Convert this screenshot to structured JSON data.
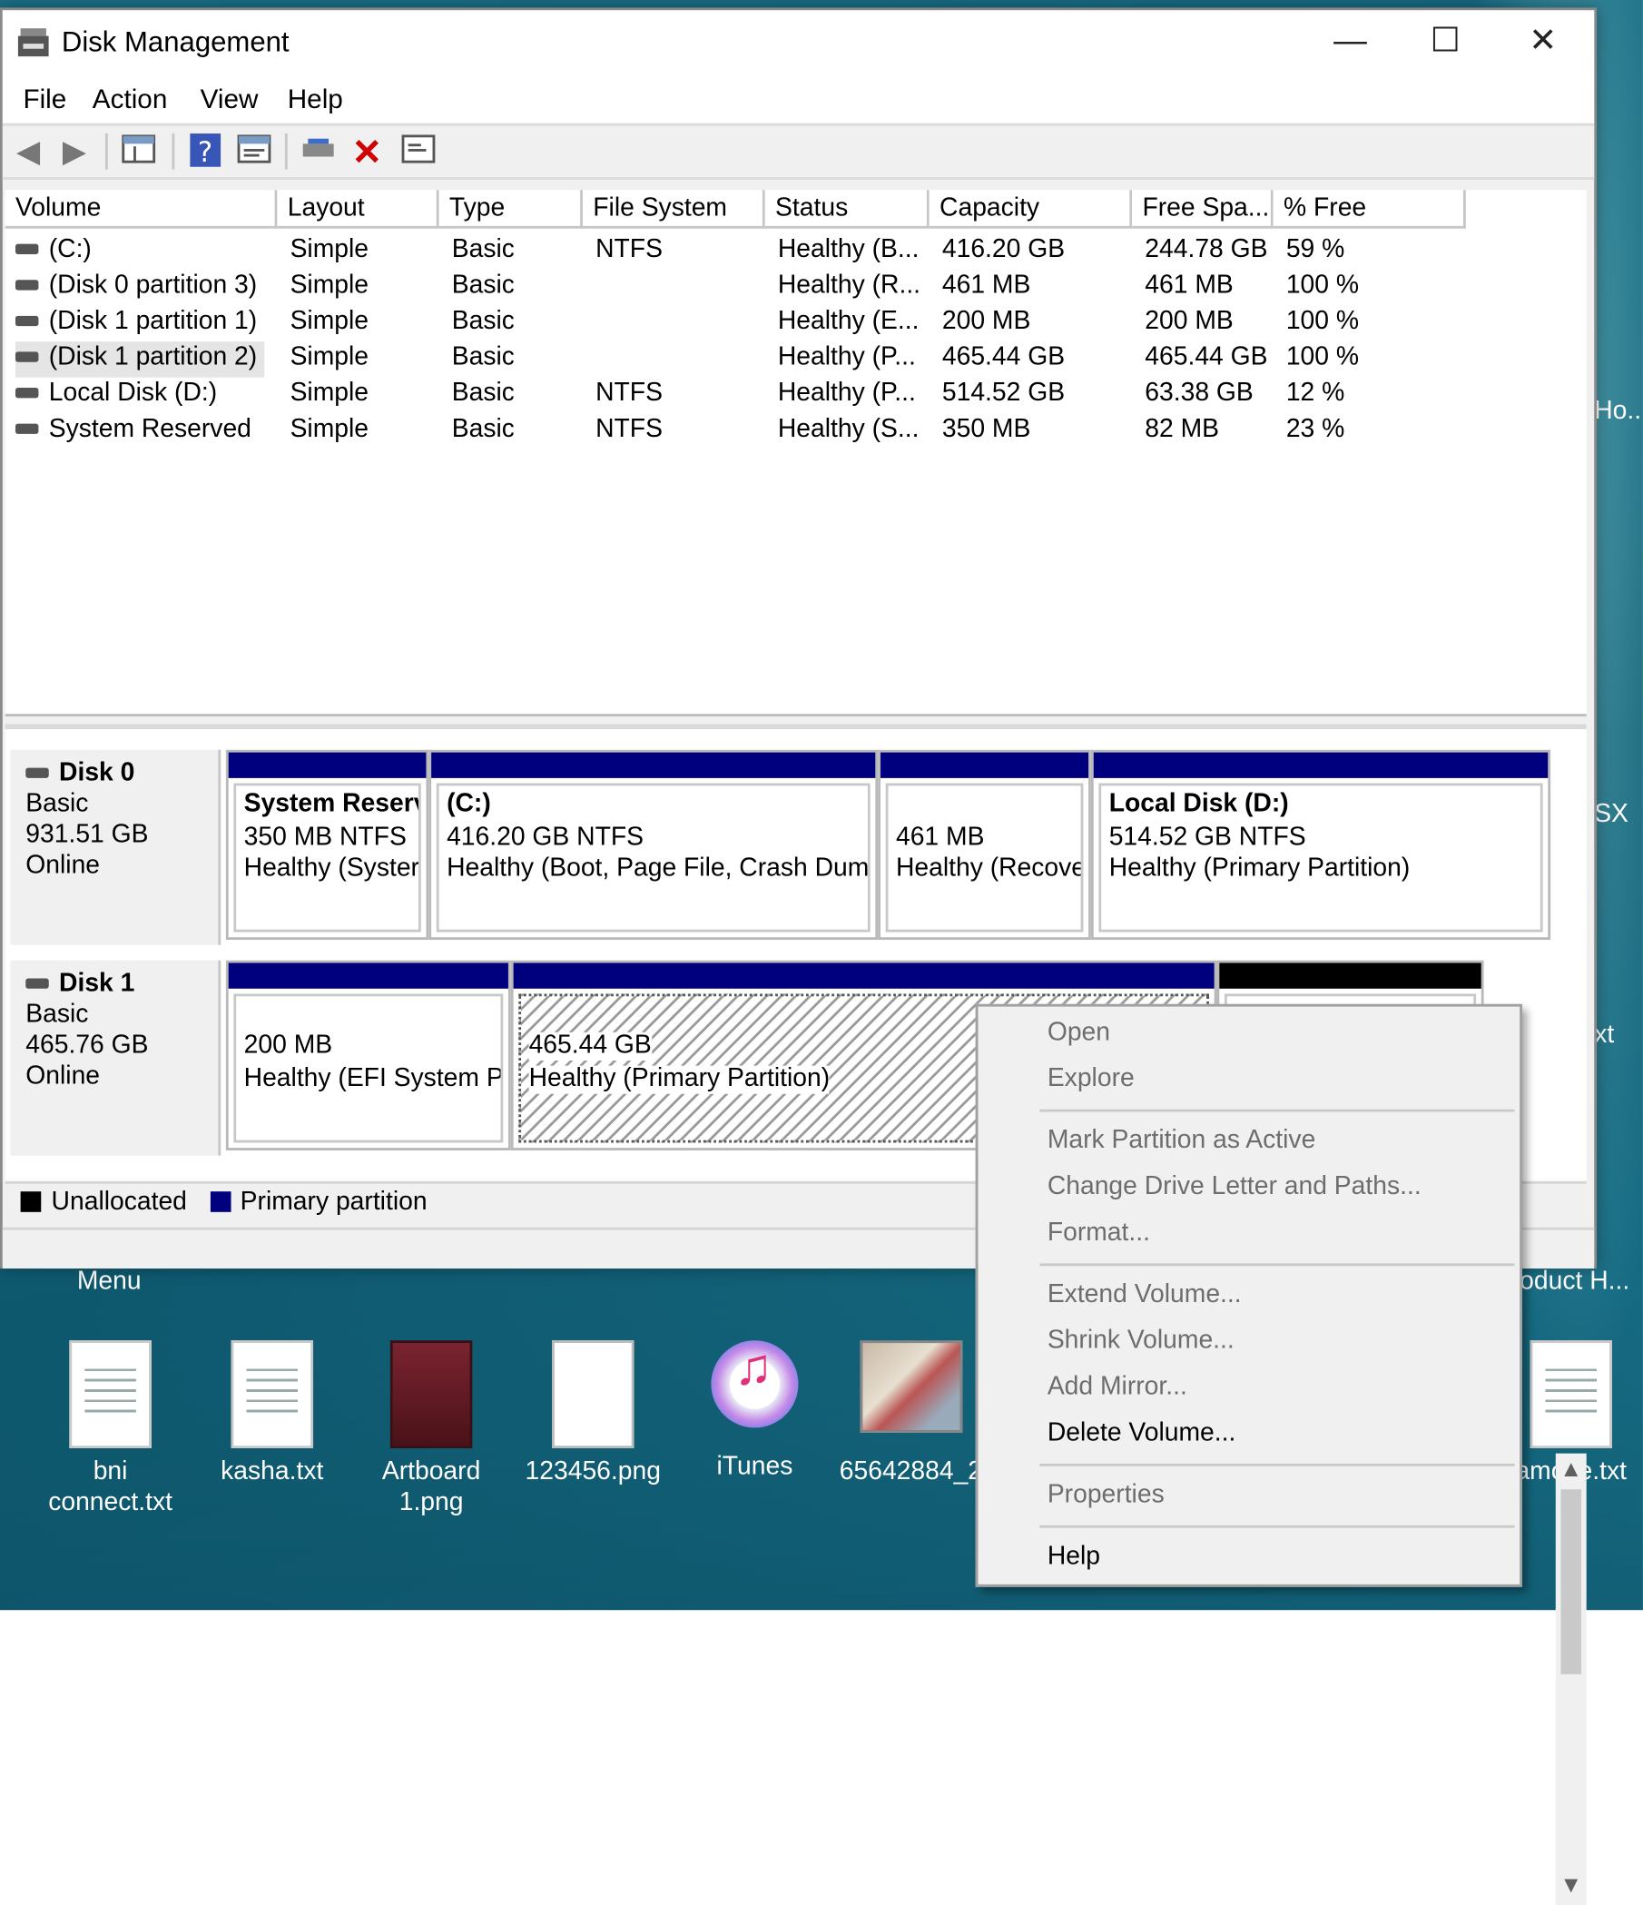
{
  "window": {
    "title": "Disk Management",
    "minimize": "—",
    "maximize": "☐",
    "close": "✕"
  },
  "menubar": [
    "File",
    "Action",
    "View",
    "Help"
  ],
  "volume_list": {
    "columns": [
      "Volume",
      "Layout",
      "Type",
      "File System",
      "Status",
      "Capacity",
      "Free Spa...",
      "% Free"
    ],
    "rows": [
      [
        "(C:)",
        "Simple",
        "Basic",
        "NTFS",
        "Healthy (B...",
        "416.20 GB",
        "244.78 GB",
        "59 %"
      ],
      [
        "(Disk 0 partition 3)",
        "Simple",
        "Basic",
        "",
        "Healthy (R...",
        "461 MB",
        "461 MB",
        "100 %"
      ],
      [
        "(Disk 1 partition 1)",
        "Simple",
        "Basic",
        "",
        "Healthy (E...",
        "200 MB",
        "200 MB",
        "100 %"
      ],
      [
        "(Disk 1 partition 2)",
        "Simple",
        "Basic",
        "",
        "Healthy (P...",
        "465.44 GB",
        "465.44 GB",
        "100 %"
      ],
      [
        "Local Disk (D:)",
        "Simple",
        "Basic",
        "NTFS",
        "Healthy (P...",
        "514.52 GB",
        "63.38 GB",
        "12 %"
      ],
      [
        "System Reserved",
        "Simple",
        "Basic",
        "NTFS",
        "Healthy (S...",
        "350 MB",
        "82 MB",
        "23 %"
      ]
    ]
  },
  "disks": [
    {
      "name": "Disk 0",
      "type": "Basic",
      "size": "931.51 GB",
      "state": "Online",
      "partitions": [
        {
          "title": "System Reserv",
          "line1": "350 MB NTFS",
          "line2": "Healthy (Syster"
        },
        {
          "title": "(C:)",
          "line1": "416.20 GB NTFS",
          "line2": "Healthy (Boot, Page File, Crash Dump"
        },
        {
          "title": "",
          "line1": "461 MB",
          "line2": "Healthy (Recove"
        },
        {
          "title": "Local Disk  (D:)",
          "line1": "514.52 GB NTFS",
          "line2": "Healthy (Primary Partition)"
        }
      ]
    },
    {
      "name": "Disk 1",
      "type": "Basic",
      "size": "465.76 GB",
      "state": "Online",
      "partitions": [
        {
          "title": "",
          "line1": "200 MB",
          "line2": "Healthy (EFI System Pa"
        },
        {
          "title": "",
          "line1": "465.44 GB",
          "line2": "Healthy (Primary Partition)"
        },
        {
          "title": "",
          "line1": "",
          "line2": ""
        }
      ]
    }
  ],
  "legend": {
    "unallocated": "Unallocated",
    "primary": "Primary partition",
    "colors": {
      "unallocated": "#000000",
      "primary": "#00007f"
    }
  },
  "context_menu": {
    "items": [
      {
        "label": "Open",
        "enabled": false
      },
      {
        "label": "Explore",
        "enabled": false
      },
      {
        "label": "Mark Partition as Active",
        "enabled": false
      },
      {
        "label": "Change Drive Letter and Paths...",
        "enabled": false
      },
      {
        "label": "Format...",
        "enabled": false
      },
      {
        "label": "Extend Volume...",
        "enabled": false
      },
      {
        "label": "Shrink Volume...",
        "enabled": false
      },
      {
        "label": "Add Mirror...",
        "enabled": false
      },
      {
        "label": "Delete Volume...",
        "enabled": true
      },
      {
        "label": "Properties",
        "enabled": false
      },
      {
        "label": "Help",
        "enabled": true
      }
    ]
  },
  "desktop": {
    "icons": [
      {
        "label": "bni connect.txt",
        "icon": "text-file-icon"
      },
      {
        "label": "kasha.txt",
        "icon": "text-file-icon"
      },
      {
        "label": "Artboard 1.png",
        "icon": "image-file-icon"
      },
      {
        "label": "123456.png",
        "icon": "image-file-icon"
      },
      {
        "label": "iTunes",
        "icon": "itunes-icon"
      },
      {
        "label": "65642884_2...",
        "icon": "photo-icon"
      },
      {
        "label": "amove.txt",
        "icon": "text-file-icon"
      }
    ],
    "partial_labels": [
      "Menu",
      "oduct H...",
      "SX",
      "Ho...",
      "xt",
      "e"
    ]
  }
}
